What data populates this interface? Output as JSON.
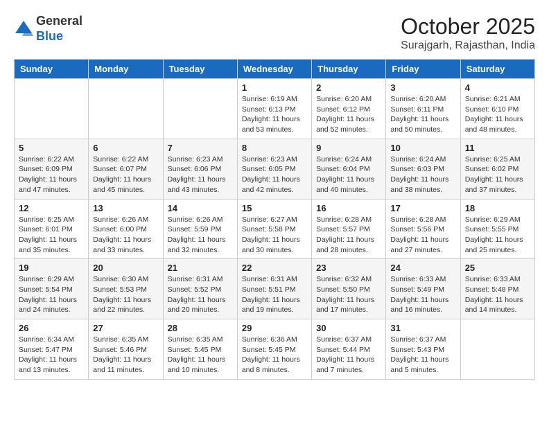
{
  "header": {
    "logo_general": "General",
    "logo_blue": "Blue",
    "month": "October 2025",
    "location": "Surajgarh, Rajasthan, India"
  },
  "weekdays": [
    "Sunday",
    "Monday",
    "Tuesday",
    "Wednesday",
    "Thursday",
    "Friday",
    "Saturday"
  ],
  "weeks": [
    [
      {
        "day": "",
        "info": ""
      },
      {
        "day": "",
        "info": ""
      },
      {
        "day": "",
        "info": ""
      },
      {
        "day": "1",
        "info": "Sunrise: 6:19 AM\nSunset: 6:13 PM\nDaylight: 11 hours\nand 53 minutes."
      },
      {
        "day": "2",
        "info": "Sunrise: 6:20 AM\nSunset: 6:12 PM\nDaylight: 11 hours\nand 52 minutes."
      },
      {
        "day": "3",
        "info": "Sunrise: 6:20 AM\nSunset: 6:11 PM\nDaylight: 11 hours\nand 50 minutes."
      },
      {
        "day": "4",
        "info": "Sunrise: 6:21 AM\nSunset: 6:10 PM\nDaylight: 11 hours\nand 48 minutes."
      }
    ],
    [
      {
        "day": "5",
        "info": "Sunrise: 6:22 AM\nSunset: 6:09 PM\nDaylight: 11 hours\nand 47 minutes."
      },
      {
        "day": "6",
        "info": "Sunrise: 6:22 AM\nSunset: 6:07 PM\nDaylight: 11 hours\nand 45 minutes."
      },
      {
        "day": "7",
        "info": "Sunrise: 6:23 AM\nSunset: 6:06 PM\nDaylight: 11 hours\nand 43 minutes."
      },
      {
        "day": "8",
        "info": "Sunrise: 6:23 AM\nSunset: 6:05 PM\nDaylight: 11 hours\nand 42 minutes."
      },
      {
        "day": "9",
        "info": "Sunrise: 6:24 AM\nSunset: 6:04 PM\nDaylight: 11 hours\nand 40 minutes."
      },
      {
        "day": "10",
        "info": "Sunrise: 6:24 AM\nSunset: 6:03 PM\nDaylight: 11 hours\nand 38 minutes."
      },
      {
        "day": "11",
        "info": "Sunrise: 6:25 AM\nSunset: 6:02 PM\nDaylight: 11 hours\nand 37 minutes."
      }
    ],
    [
      {
        "day": "12",
        "info": "Sunrise: 6:25 AM\nSunset: 6:01 PM\nDaylight: 11 hours\nand 35 minutes."
      },
      {
        "day": "13",
        "info": "Sunrise: 6:26 AM\nSunset: 6:00 PM\nDaylight: 11 hours\nand 33 minutes."
      },
      {
        "day": "14",
        "info": "Sunrise: 6:26 AM\nSunset: 5:59 PM\nDaylight: 11 hours\nand 32 minutes."
      },
      {
        "day": "15",
        "info": "Sunrise: 6:27 AM\nSunset: 5:58 PM\nDaylight: 11 hours\nand 30 minutes."
      },
      {
        "day": "16",
        "info": "Sunrise: 6:28 AM\nSunset: 5:57 PM\nDaylight: 11 hours\nand 28 minutes."
      },
      {
        "day": "17",
        "info": "Sunrise: 6:28 AM\nSunset: 5:56 PM\nDaylight: 11 hours\nand 27 minutes."
      },
      {
        "day": "18",
        "info": "Sunrise: 6:29 AM\nSunset: 5:55 PM\nDaylight: 11 hours\nand 25 minutes."
      }
    ],
    [
      {
        "day": "19",
        "info": "Sunrise: 6:29 AM\nSunset: 5:54 PM\nDaylight: 11 hours\nand 24 minutes."
      },
      {
        "day": "20",
        "info": "Sunrise: 6:30 AM\nSunset: 5:53 PM\nDaylight: 11 hours\nand 22 minutes."
      },
      {
        "day": "21",
        "info": "Sunrise: 6:31 AM\nSunset: 5:52 PM\nDaylight: 11 hours\nand 20 minutes."
      },
      {
        "day": "22",
        "info": "Sunrise: 6:31 AM\nSunset: 5:51 PM\nDaylight: 11 hours\nand 19 minutes."
      },
      {
        "day": "23",
        "info": "Sunrise: 6:32 AM\nSunset: 5:50 PM\nDaylight: 11 hours\nand 17 minutes."
      },
      {
        "day": "24",
        "info": "Sunrise: 6:33 AM\nSunset: 5:49 PM\nDaylight: 11 hours\nand 16 minutes."
      },
      {
        "day": "25",
        "info": "Sunrise: 6:33 AM\nSunset: 5:48 PM\nDaylight: 11 hours\nand 14 minutes."
      }
    ],
    [
      {
        "day": "26",
        "info": "Sunrise: 6:34 AM\nSunset: 5:47 PM\nDaylight: 11 hours\nand 13 minutes."
      },
      {
        "day": "27",
        "info": "Sunrise: 6:35 AM\nSunset: 5:46 PM\nDaylight: 11 hours\nand 11 minutes."
      },
      {
        "day": "28",
        "info": "Sunrise: 6:35 AM\nSunset: 5:45 PM\nDaylight: 11 hours\nand 10 minutes."
      },
      {
        "day": "29",
        "info": "Sunrise: 6:36 AM\nSunset: 5:45 PM\nDaylight: 11 hours\nand 8 minutes."
      },
      {
        "day": "30",
        "info": "Sunrise: 6:37 AM\nSunset: 5:44 PM\nDaylight: 11 hours\nand 7 minutes."
      },
      {
        "day": "31",
        "info": "Sunrise: 6:37 AM\nSunset: 5:43 PM\nDaylight: 11 hours\nand 5 minutes."
      },
      {
        "day": "",
        "info": ""
      }
    ]
  ]
}
